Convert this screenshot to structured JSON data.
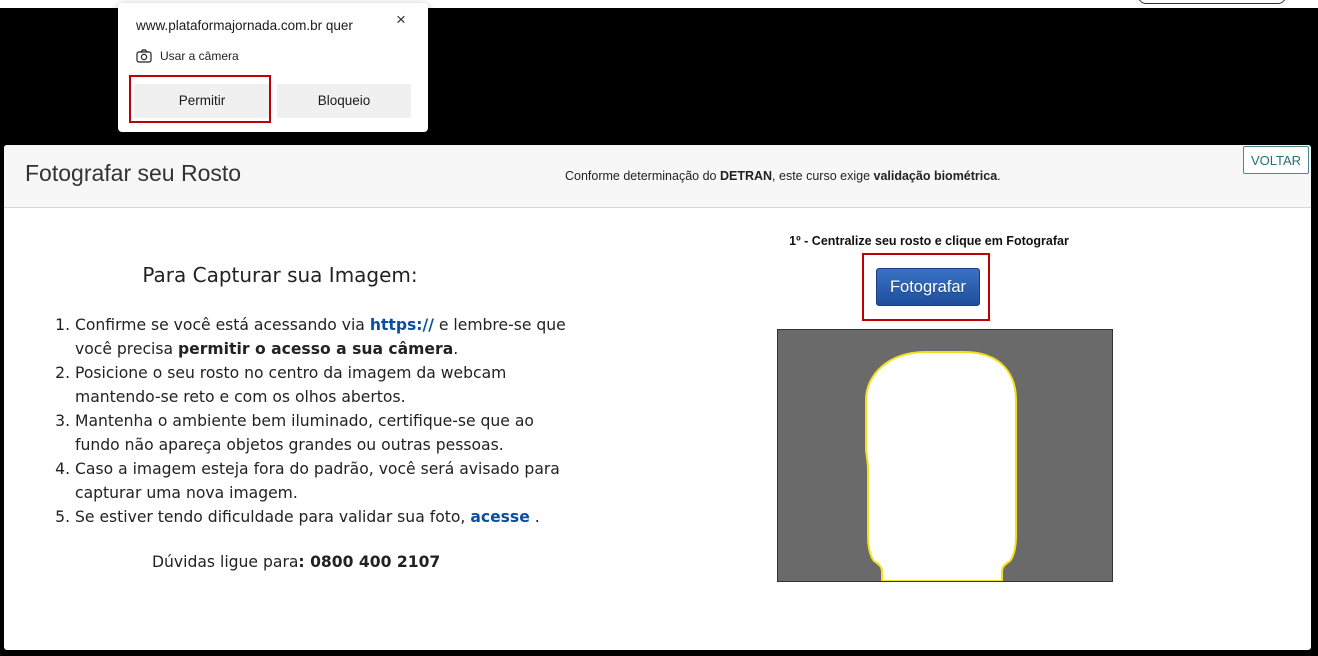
{
  "permission_popup": {
    "site": "www.plataformajornada.com.br quer",
    "close_icon": "×",
    "camera_label": "Usar a câmera",
    "allow_label": "Permitir",
    "block_label": "Bloqueio"
  },
  "header": {
    "title": "Fotografar seu Rosto",
    "subtitle_pre": "Conforme determinação do ",
    "subtitle_detran": "DETRAN",
    "subtitle_mid": ", este curso exige ",
    "subtitle_bio": "validação biométrica",
    "subtitle_end": ".",
    "back_label": "VOLTAR"
  },
  "instructions": {
    "title": "Para Capturar sua Imagem:",
    "step1_pre": "Confirme se você está acessando via ",
    "step1_link": "https://",
    "step1_mid": " e lembre-se que você precisa ",
    "step1_bold": "permitir o acesso a sua câmera",
    "step1_end": ".",
    "step2": "Posicione o seu rosto no centro da imagem da webcam mantendo-se reto e com os olhos abertos.",
    "step3": "Mantenha o ambiente bem iluminado, certifique-se que ao fundo não apareça objetos grandes ou outras pessoas.",
    "step4": "Caso a imagem esteja fora do padrão, você será avisado para capturar uma nova imagem.",
    "step5_pre": "Se estiver tendo dificuldade para validar sua foto, ",
    "step5_link": "acesse",
    "step5_end": " .",
    "help_pre": "Dúvidas ligue para",
    "help_phone": ": 0800 400 2107"
  },
  "capture": {
    "instruction": "1º - Centralize seu rosto e clique em Fotografar",
    "button_label": "Fotografar"
  },
  "colors": {
    "link": "#0b4ea2",
    "button": "#1d4f9c",
    "highlight": "#c00000",
    "camera_bg": "#6a6a6a",
    "silhouette_outline": "#f2e01a"
  }
}
